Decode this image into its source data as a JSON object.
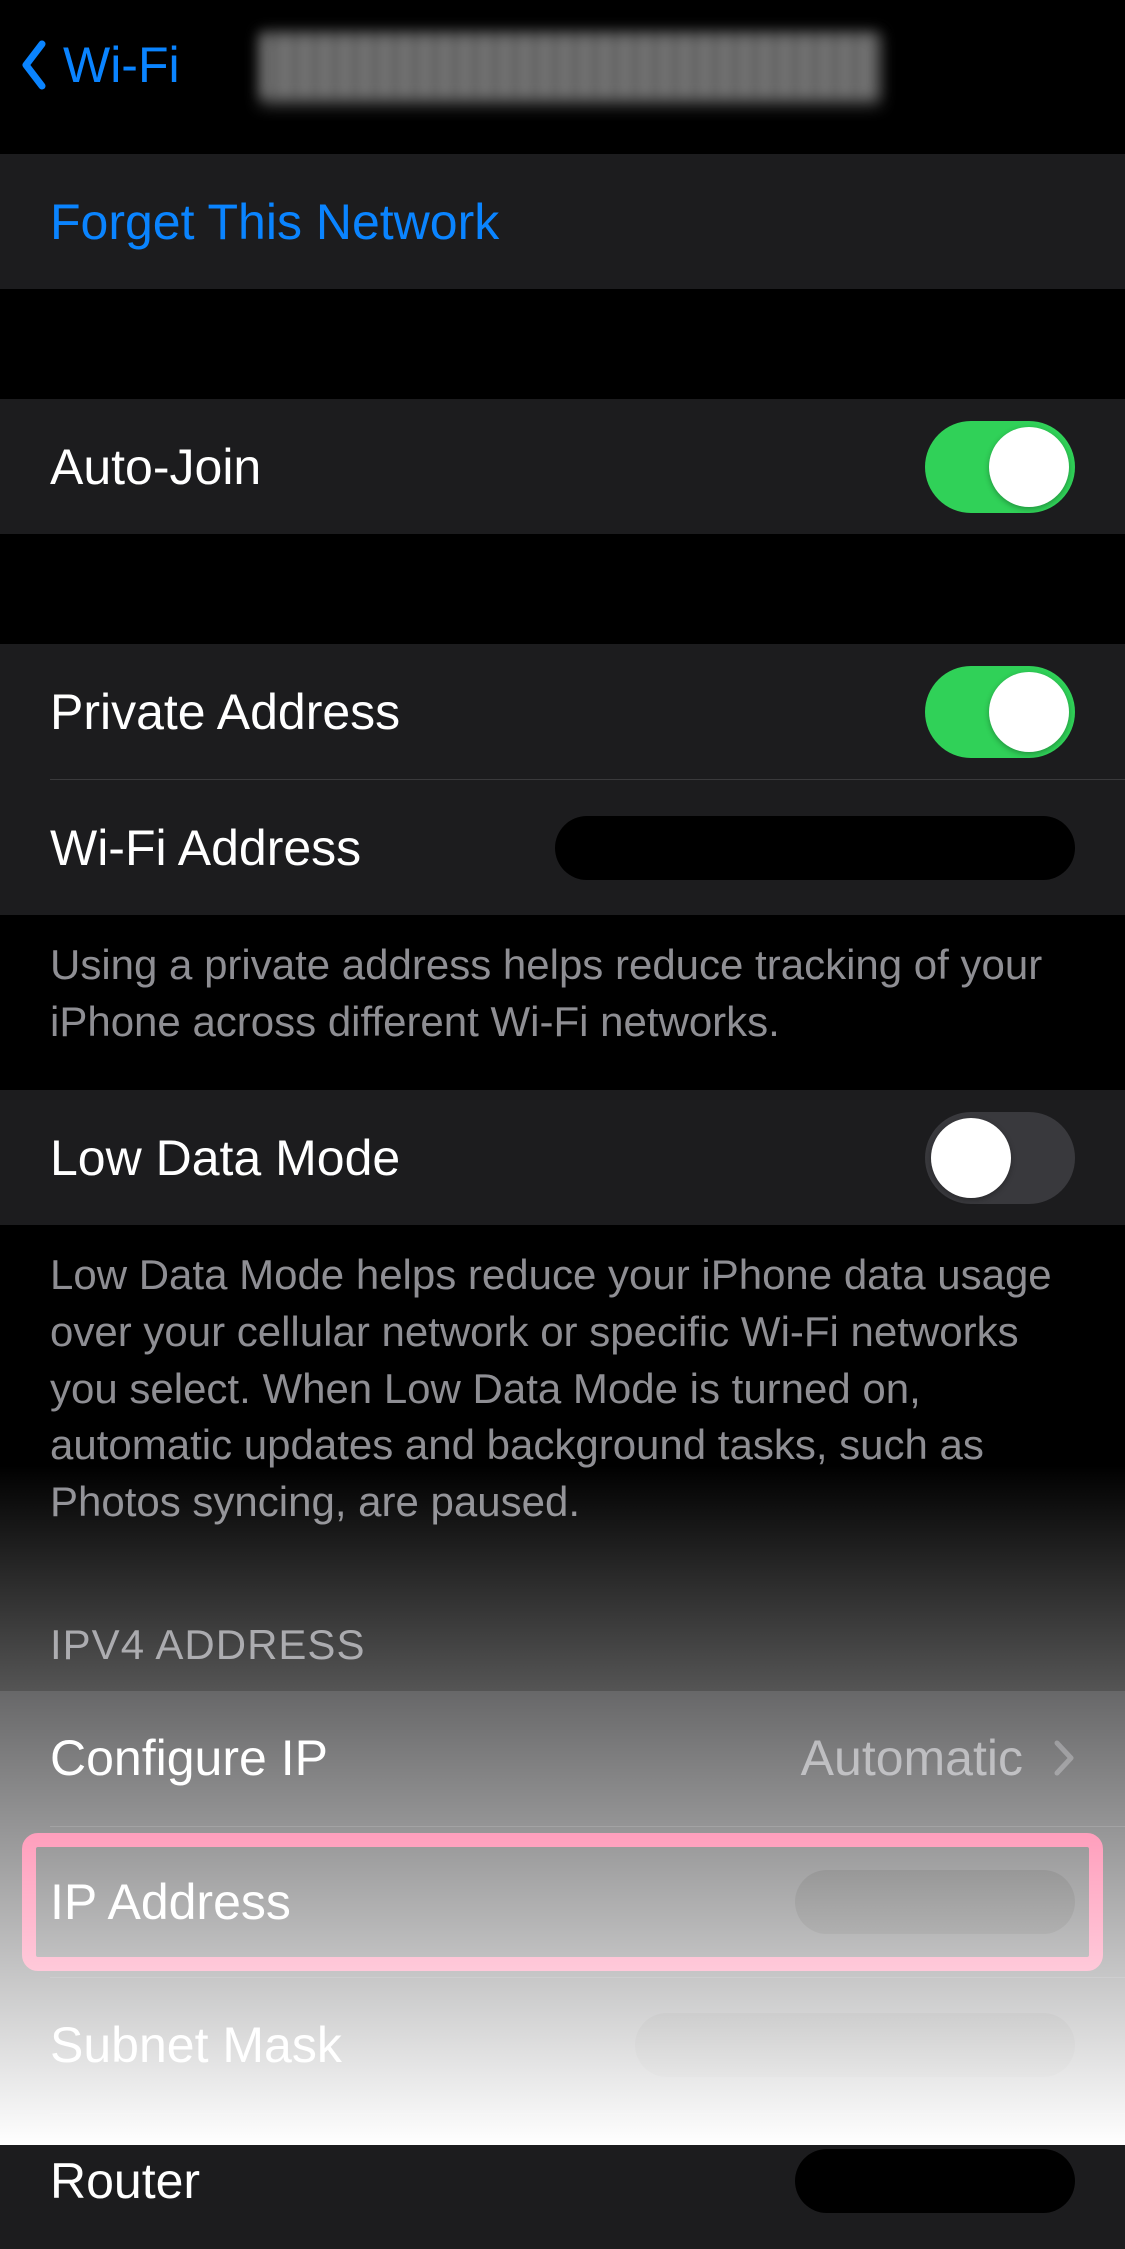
{
  "nav": {
    "back_label": "Wi-Fi"
  },
  "actions": {
    "forget_network": "Forget This Network"
  },
  "auto_join": {
    "label": "Auto-Join"
  },
  "private_address": {
    "label": "Private Address"
  },
  "wifi_address": {
    "label": "Wi-Fi Address"
  },
  "private_footer": "Using a private address helps reduce tracking of your iPhone across different Wi-Fi networks.",
  "low_data": {
    "label": "Low Data Mode",
    "footer": "Low Data Mode helps reduce your iPhone data usage over your cellular network or specific Wi-Fi networks you select. When Low Data Mode is turned on, automatic updates and background tasks, such as Photos syncing, are paused."
  },
  "ipv4": {
    "header": "IPV4 ADDRESS",
    "configure_label": "Configure IP",
    "configure_value": "Automatic",
    "ip_label": "IP Address",
    "subnet_label": "Subnet Mask",
    "router_label": "Router"
  }
}
